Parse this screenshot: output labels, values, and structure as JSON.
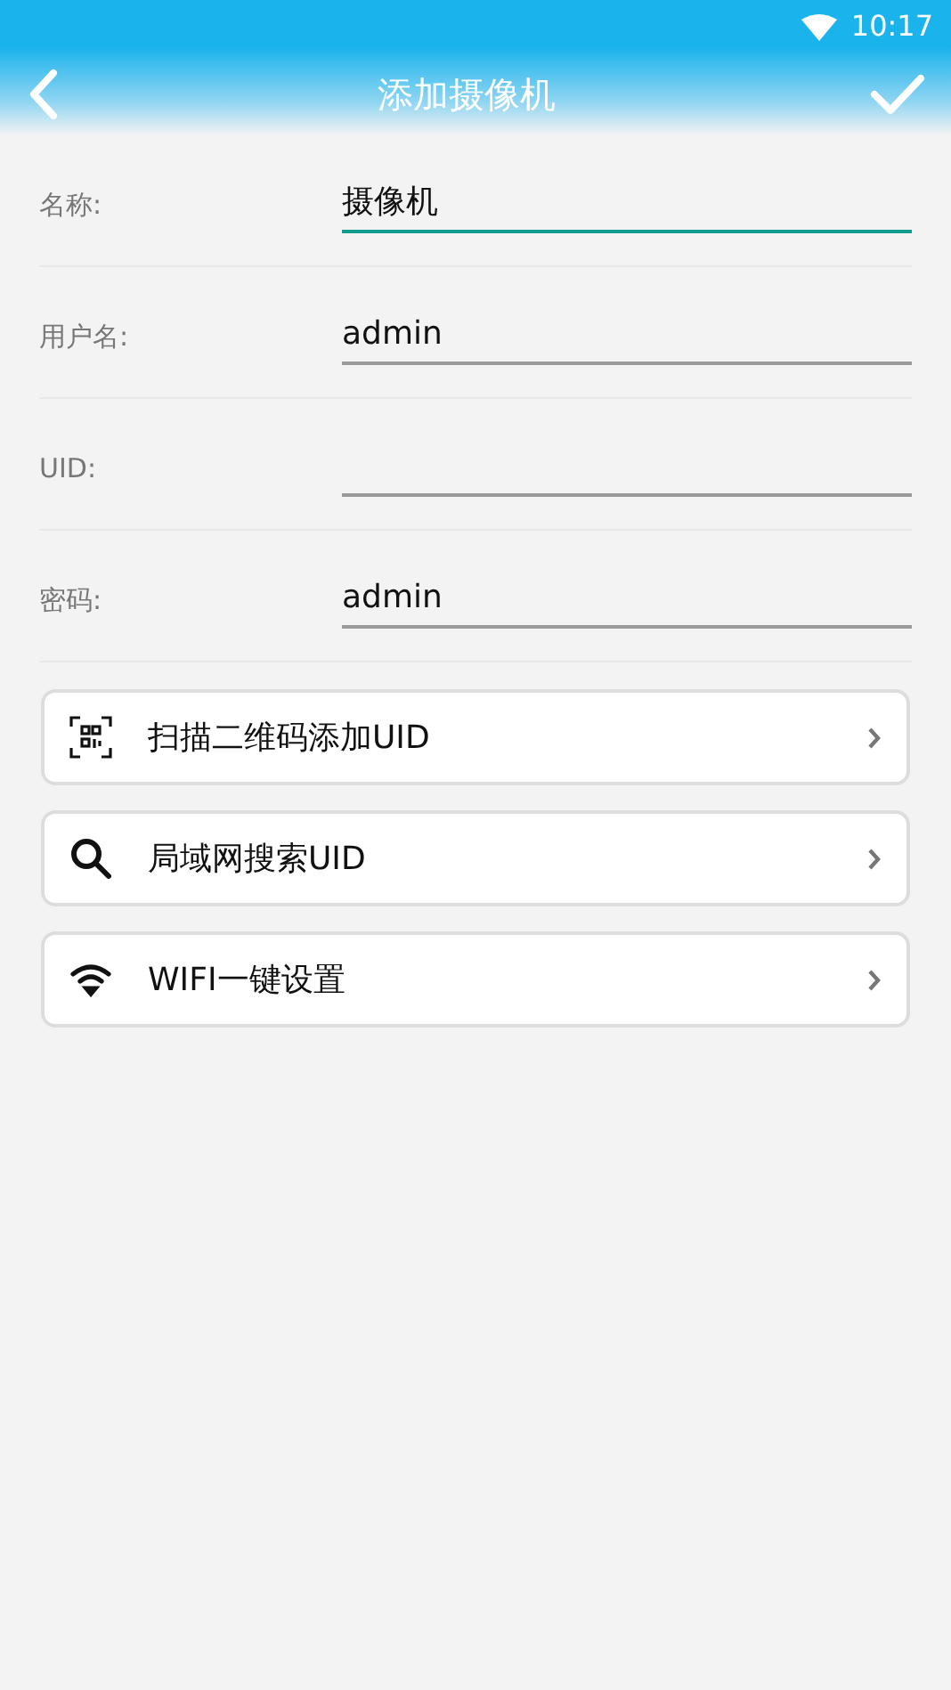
{
  "status_bar": {
    "time": "10:17"
  },
  "header": {
    "title": "添加摄像机"
  },
  "fields": [
    {
      "label": "名称:",
      "value": "摄像机",
      "focused": true
    },
    {
      "label": "用户名:",
      "value": "admin",
      "focused": false
    },
    {
      "label": "UID:",
      "focused": false
    },
    {
      "label": "密码:",
      "value": "admin",
      "focused": false
    }
  ],
  "actions": [
    {
      "kind": "qr",
      "label": "扫描二维码添加UID"
    },
    {
      "kind": "search",
      "label": "局域网搜索UID"
    },
    {
      "kind": "wifi",
      "label": "WIFI一键设置"
    }
  ]
}
